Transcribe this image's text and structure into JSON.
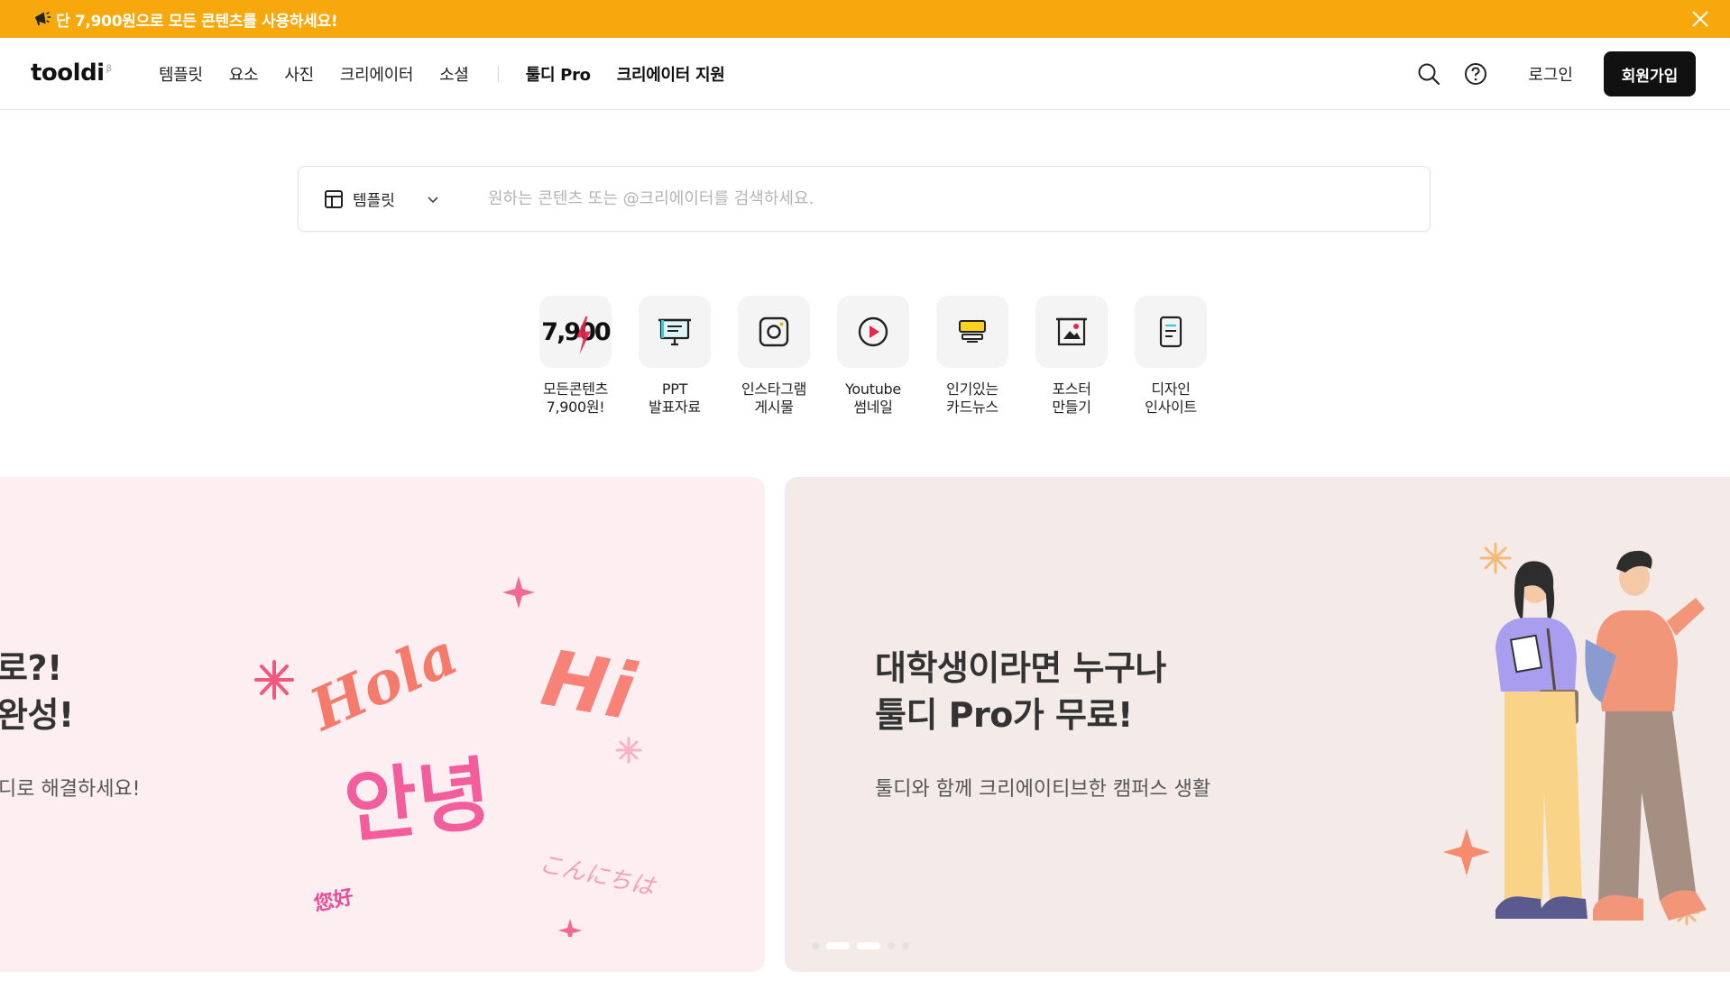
{
  "promo": {
    "text": "단 7,900원으로 모든 콘텐츠를 사용하세요!",
    "icon": "megaphone-icon",
    "close_icon": "close-icon",
    "bg_color": "#f7a80d"
  },
  "header": {
    "logo": "tooldi",
    "logo_badge": "β",
    "nav": [
      {
        "label": "템플릿"
      },
      {
        "label": "요소"
      },
      {
        "label": "사진"
      },
      {
        "label": "크리에이터"
      },
      {
        "label": "소셜"
      }
    ],
    "nav_bold": [
      {
        "label": "툴디 Pro"
      },
      {
        "label": "크리에이터 지원"
      }
    ],
    "login": "로그인",
    "signup": "회원가입"
  },
  "search": {
    "type_label": "템플릿",
    "placeholder": "원하는 콘텐츠 또는 @크리에이터를 검색하세요."
  },
  "categories": [
    {
      "label": "모든콘텐츠\n7,900원!",
      "icon": "price-7900-icon",
      "mark": "7,900"
    },
    {
      "label": "PPT\n발표자료",
      "icon": "presentation-icon"
    },
    {
      "label": "인스타그램\n게시물",
      "icon": "instagram-icon"
    },
    {
      "label": "Youtube\n썸네일",
      "icon": "youtube-play-icon"
    },
    {
      "label": "인기있는\n카드뉴스",
      "icon": "card-news-icon"
    },
    {
      "label": "포스터\n만들기",
      "icon": "poster-icon"
    },
    {
      "label": "디자인\n인사이트",
      "icon": "document-icon"
    }
  ],
  "banners": [
    {
      "title": "로?!\n완성!",
      "subtitle": "디로 해결하세요!",
      "art_words": [
        "Hola",
        "Hi",
        "안녕",
        "こんにちは",
        "您好"
      ]
    },
    {
      "title": "대학생이라면 누구나\n툴디 Pro가 무료!",
      "subtitle": "툴디와 함께 크리에이티브한 캠퍼스 생활"
    }
  ],
  "carousel": {
    "count": 5,
    "active_index": 1
  }
}
